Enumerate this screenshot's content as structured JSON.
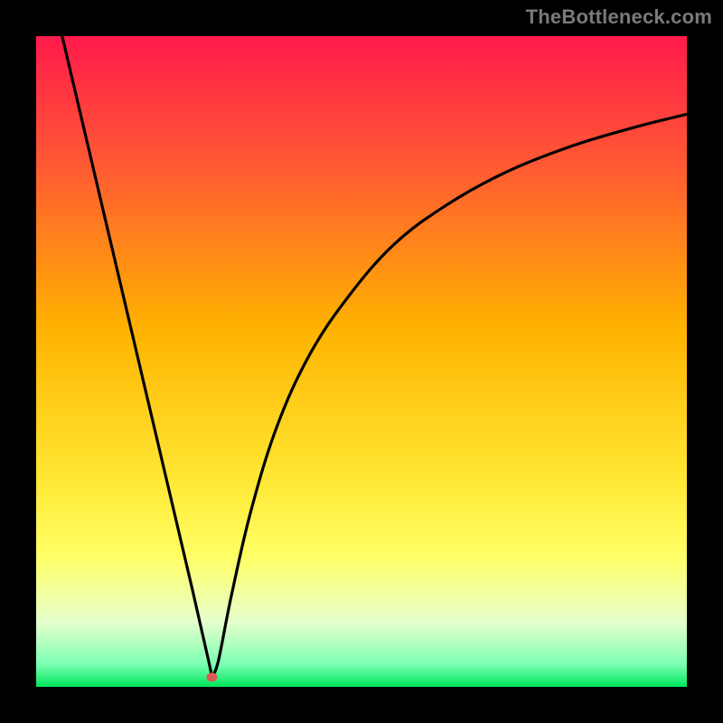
{
  "watermark": "TheBottleneck.com",
  "colors": {
    "top": "#ff1a4b",
    "mid": "#ffb300",
    "low_yellow": "#ffff66",
    "pale": "#e6ffcc",
    "green": "#00e65c",
    "curve": "#000000",
    "marker": "#d95b52",
    "background": "#000000"
  },
  "chart_data": {
    "type": "line",
    "title": "",
    "xlabel": "",
    "ylabel": "",
    "xlim": [
      0,
      100
    ],
    "ylim": [
      0,
      100
    ],
    "grid": false,
    "legend": false,
    "annotations": [],
    "marker": {
      "x": 27,
      "y": 1.5
    },
    "series": [
      {
        "name": "left-branch",
        "x": [
          4,
          8,
          12,
          16,
          20,
          24,
          26.5,
          27
        ],
        "y": [
          100,
          83,
          66,
          49,
          32,
          15,
          4,
          1.5
        ]
      },
      {
        "name": "right-branch",
        "x": [
          27,
          28,
          30,
          33,
          37,
          42,
          48,
          55,
          63,
          72,
          82,
          92,
          100
        ],
        "y": [
          1.5,
          4,
          14,
          27,
          40,
          51,
          60,
          68,
          74,
          79,
          83,
          86,
          88
        ]
      }
    ],
    "gradient_stops": [
      {
        "pos": 0.0,
        "color": "#ff1a4b"
      },
      {
        "pos": 0.2,
        "color": "#ff5a33"
      },
      {
        "pos": 0.45,
        "color": "#ffb300"
      },
      {
        "pos": 0.68,
        "color": "#ffe733"
      },
      {
        "pos": 0.8,
        "color": "#ffff66"
      },
      {
        "pos": 0.9,
        "color": "#e6ffcc"
      },
      {
        "pos": 0.965,
        "color": "#7dffb3"
      },
      {
        "pos": 1.0,
        "color": "#00e65c"
      }
    ]
  }
}
